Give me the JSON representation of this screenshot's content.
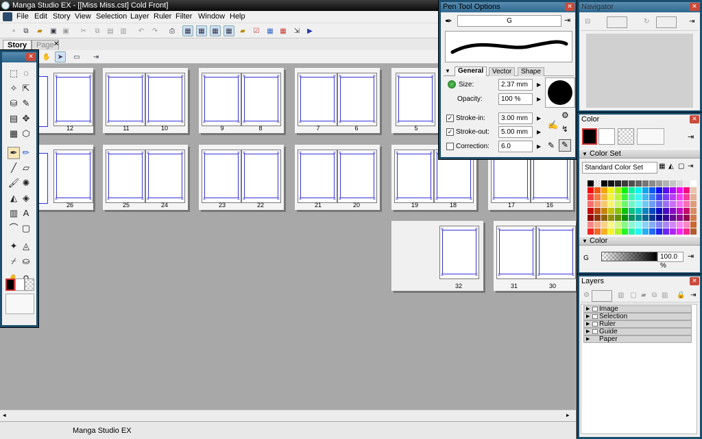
{
  "window": {
    "title": "Manga Studio EX - [[Miss Miss.cst] Cold Front]"
  },
  "menu": [
    "File",
    "Edit",
    "Story",
    "View",
    "Selection",
    "Layer",
    "Ruler",
    "Filter",
    "Window",
    "Help"
  ],
  "tabs": [
    {
      "label": "Story",
      "active": true
    },
    {
      "label": "Page",
      "active": false
    }
  ],
  "spreads": {
    "row1": [
      {
        "left": "",
        "right": "12"
      },
      {
        "left": "11",
        "right": "10"
      },
      {
        "left": "9",
        "right": "8"
      },
      {
        "left": "7",
        "right": "6"
      },
      {
        "left": "5",
        "right": ""
      }
    ],
    "row2": [
      {
        "left": "",
        "right": "26"
      },
      {
        "left": "25",
        "right": "24"
      },
      {
        "left": "23",
        "right": "22"
      },
      {
        "left": "21",
        "right": "20"
      },
      {
        "left": "19",
        "right": "18"
      },
      {
        "left": "17",
        "right": "16"
      }
    ],
    "row3": [
      {
        "left": "32",
        "right": ""
      },
      {
        "left": "31",
        "right": "30"
      }
    ]
  },
  "status": {
    "text": "Manga Studio EX"
  },
  "pen_tool": {
    "title": "Pen Tool Options",
    "name": "G",
    "tabs": [
      "General",
      "Vector",
      "Shape"
    ],
    "size_label": "Size:",
    "size_value": "2.37 mm",
    "opacity_label": "Opacity:",
    "opacity_value": "100 %",
    "stroke_in_label": "Stroke-in:",
    "stroke_in_value": "3.00 mm",
    "stroke_in_checked": true,
    "stroke_out_label": "Stroke-out:",
    "stroke_out_value": "5.00 mm",
    "stroke_out_checked": true,
    "correction_label": "Correction:",
    "correction_value": "6.0",
    "correction_checked": false
  },
  "navigator": {
    "title": "Navigator"
  },
  "color": {
    "title": "Color",
    "color_set_header": "Color Set",
    "color_set_value": "Standard Color Set",
    "color_header": "Color",
    "channel_label": "G",
    "channel_value": "100.0 %"
  },
  "layers": {
    "title": "Layers",
    "items": [
      "Image",
      "Selection",
      "Ruler",
      "Guide",
      "Paper"
    ]
  },
  "colors": {
    "accent": "#3030d8",
    "palette_border": "#1b4e6e"
  }
}
